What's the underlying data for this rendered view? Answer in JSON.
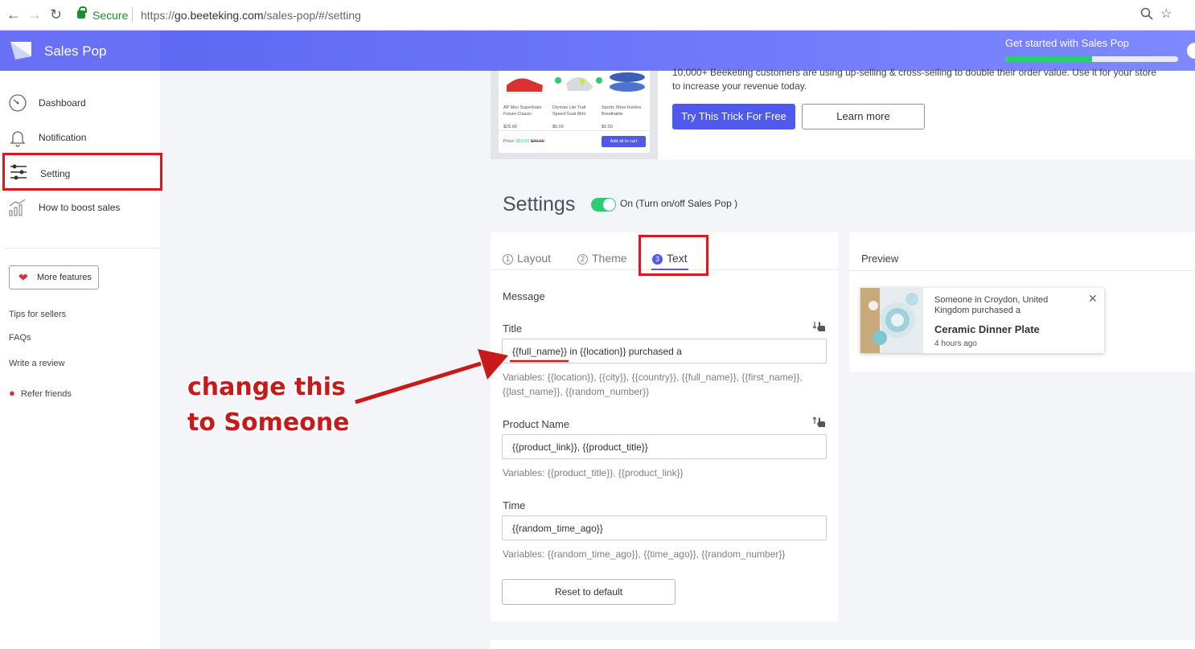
{
  "browser": {
    "secure_label": "Secure",
    "url_prefix": "https://",
    "url_host": "go.beeteking.com",
    "url_path": "/sales-pop/#/setting"
  },
  "header": {
    "brand": "Sales Pop",
    "get_started": "Get started with Sales Pop",
    "progress_percent": 50
  },
  "sidebar": {
    "items": [
      {
        "label": "Dashboard",
        "icon": "dashboard-icon"
      },
      {
        "label": "Notification",
        "icon": "bell-icon"
      },
      {
        "label": "Setting",
        "icon": "sliders-icon"
      },
      {
        "label": "How to boost sales",
        "icon": "chart-icon"
      }
    ],
    "more_features": "More features",
    "links": [
      "Tips for sellers",
      "FAQs",
      "Write a review",
      "Refer friends"
    ]
  },
  "promo": {
    "text_line1": "10,000+ Beeketing customers are using up-selling & cross-selling to double their order value. Use it for your store",
    "text_line2": "to increase your revenue today.",
    "try_button": "Try This Trick For Free",
    "learn_button": "Learn more",
    "products": [
      {
        "name": "AP Moc Superfoam Future Classic",
        "price": "$25.00"
      },
      {
        "name": "Drymax Lite Trail Speed Goat Mini",
        "price": "$5.00"
      },
      {
        "name": "Sports Shoe Insoles Breathable",
        "price": "$9.00"
      }
    ],
    "price_label": "Price:",
    "price_new": "$29.00",
    "price_old": "$39.00",
    "add_all": "Add all to cart"
  },
  "settings": {
    "title": "Settings",
    "toggle_label": "On (Turn on/off Sales Pop )",
    "tabs": [
      {
        "num": "1",
        "label": "Layout"
      },
      {
        "num": "2",
        "label": "Theme"
      },
      {
        "num": "3",
        "label": "Text"
      }
    ],
    "section": "Message",
    "title_label": "Title",
    "title_value": "{{full_name}} in {{location}} purchased a",
    "title_vars_line1": "Variables: {{location}}, {{city}}, {{country}}, {{full_name}}, {{first_name}},",
    "title_vars_line2": "{{last_name}}, {{random_number}}",
    "product_label": "Product Name",
    "product_value": "{{product_link}}, {{product_title}}",
    "product_vars": "Variables: {{product_title}}, {{product_link}}",
    "time_label": "Time",
    "time_value": "{{random_time_ago}}",
    "time_vars": "Variables: {{random_time_ago}}, {{time_ago}}, {{random_number}}",
    "reset": "Reset to default"
  },
  "preview": {
    "heading": "Preview",
    "message": "Someone in Croydon, United Kingdom purchased a",
    "product": "Ceramic Dinner Plate",
    "time": "4 hours ago",
    "close": "✕"
  },
  "annotation": {
    "line1": "change this",
    "line2": "to Someone"
  },
  "colors": {
    "accent": "#4f59ec",
    "toggle_on": "#2ecc71",
    "annotation_red": "#c81a1a"
  }
}
